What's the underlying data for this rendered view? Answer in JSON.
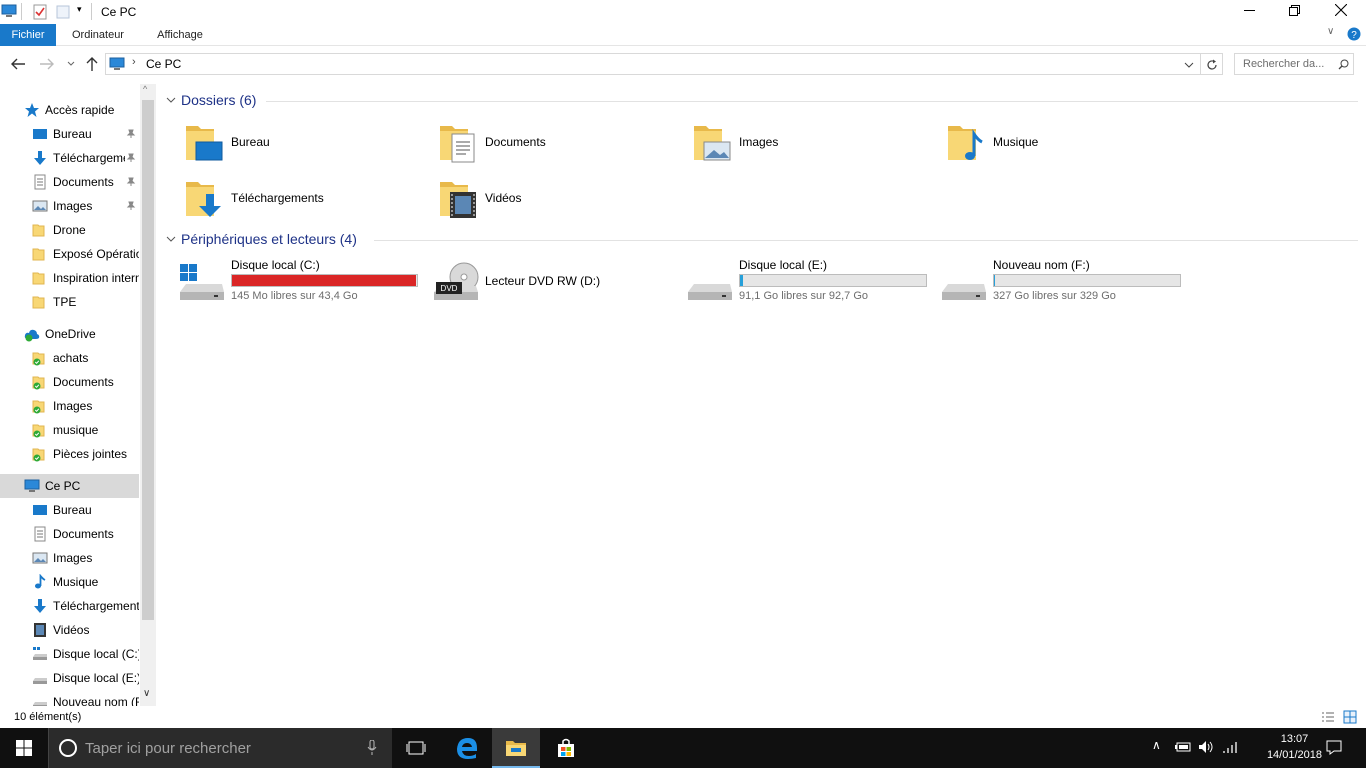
{
  "window": {
    "title": "Ce PC"
  },
  "ribbon": {
    "tabs": [
      "Fichier",
      "Ordinateur",
      "Affichage"
    ]
  },
  "address": {
    "path": "Ce PC",
    "search_placeholder": "Rechercher da..."
  },
  "nav": {
    "quick": {
      "label": "Accès rapide",
      "items": [
        "Bureau",
        "Téléchargements",
        "Documents",
        "Images",
        "Drone",
        "Exposé Opération",
        "Inspiration intern",
        "TPE"
      ]
    },
    "onedrive": {
      "label": "OneDrive",
      "items": [
        "achats",
        "Documents",
        "Images",
        "musique",
        "Pièces jointes"
      ]
    },
    "pc": {
      "label": "Ce PC",
      "items": [
        "Bureau",
        "Documents",
        "Images",
        "Musique",
        "Téléchargements",
        "Vidéos",
        "Disque local (C:)",
        "Disque local (E:)",
        "Nouveau nom (F"
      ]
    }
  },
  "folders": {
    "header": "Dossiers (6)",
    "items": [
      "Bureau",
      "Documents",
      "Images",
      "Musique",
      "Téléchargements",
      "Vidéos"
    ]
  },
  "devices": {
    "header": "Périphériques et lecteurs (4)",
    "items": [
      {
        "name": "Disque local (C:)",
        "free": "145 Mo libres sur 43,4 Go",
        "used_fraction": 0.997,
        "color": "#da2626"
      },
      {
        "name": "Lecteur DVD RW (D:)",
        "free": "",
        "used_fraction": null,
        "color": ""
      },
      {
        "name": "Disque local (E:)",
        "free": "91,1 Go libres sur 92,7 Go",
        "used_fraction": 0.017,
        "color": "#26a0da"
      },
      {
        "name": "Nouveau nom (F:)",
        "free": "327 Go libres sur 329 Go",
        "used_fraction": 0.006,
        "color": "#26a0da"
      }
    ]
  },
  "status": {
    "count": "10 élément(s)"
  },
  "taskbar": {
    "search_placeholder": "Taper ici pour rechercher",
    "time": "13:07",
    "date": "14/01/2018"
  }
}
